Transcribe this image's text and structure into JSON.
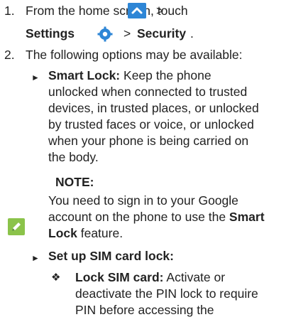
{
  "colors": {
    "accent": "#2e86d6",
    "note": "#8bc34a",
    "text": "#222222"
  },
  "steps": [
    {
      "number": "1.",
      "line1_text": "From the home screen, touch",
      "line1_tail": ">",
      "settings_label": "Settings",
      "sep": ">",
      "security_label": "Security",
      "period": ".",
      "icons": [
        "home-arrow-icon",
        "settings-gear-icon"
      ]
    },
    {
      "number": "2.",
      "text": "The following options may be available:"
    }
  ],
  "smart_lock": {
    "bullet": "►",
    "title": "Smart Lock:",
    "line1_rest": "Keep the phone",
    "lines": [
      "unlocked when connected to trusted",
      "devices, in trusted places, or unlocked",
      "by trusted faces or voice, or unlocked",
      "when your phone is being carried on",
      "the body."
    ]
  },
  "note": {
    "icon": "note-pencil-icon",
    "title": "NOTE:",
    "line1": "You need to sign in to your Google",
    "line2_pre": "account on the phone to use the ",
    "line2_bold": "Smart",
    "line3_bold": "Lock",
    "line3_rest": " feature."
  },
  "sim_lock": {
    "bullet": "►",
    "title": "Set up SIM card lock:"
  },
  "lock_sim": {
    "bullet": "❖",
    "title": "Lock SIM card:",
    "line1_rest": "Activate or",
    "lines": [
      "deactivate the PIN lock to require",
      "PIN before accessing the"
    ]
  }
}
